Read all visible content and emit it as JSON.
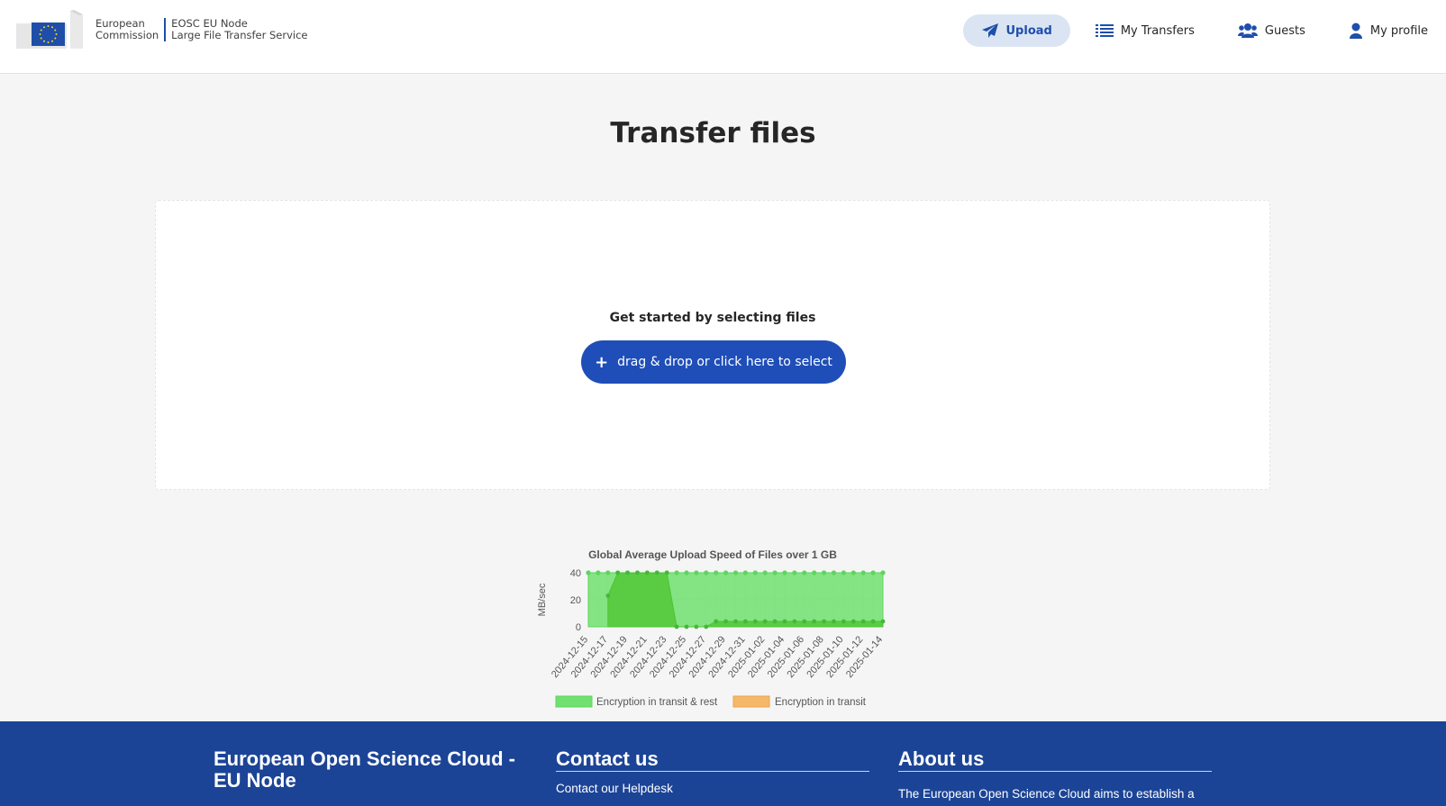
{
  "header": {
    "logo": {
      "line1": "European",
      "line2": "Commission"
    },
    "site": {
      "line1": "EOSC EU Node",
      "line2": "Large File Transfer Service"
    },
    "nav": [
      {
        "label": "Upload",
        "icon": "paper-plane-icon",
        "active": true
      },
      {
        "label": "My Transfers",
        "icon": "list-icon",
        "active": false
      },
      {
        "label": "Guests",
        "icon": "users-icon",
        "active": false
      },
      {
        "label": "My profile",
        "icon": "user-icon",
        "active": false
      }
    ]
  },
  "main": {
    "title": "Transfer files",
    "dropzone": {
      "heading": "Get started by selecting files",
      "button_label": "drag & drop or click here to select",
      "button_icon": "plus-icon"
    }
  },
  "chart_data": {
    "type": "area",
    "title": "Global Average Upload Speed of Files over 1 GB",
    "ylabel": "MB/sec",
    "xlabel": "",
    "ylim": [
      0,
      40
    ],
    "yticks": [
      0,
      20,
      40
    ],
    "grid": true,
    "legend_position": "bottom",
    "x": [
      "2024-12-15",
      "2024-12-16",
      "2024-12-17",
      "2024-12-18",
      "2024-12-19",
      "2024-12-20",
      "2024-12-21",
      "2024-12-22",
      "2024-12-23",
      "2024-12-24",
      "2024-12-25",
      "2024-12-26",
      "2024-12-27",
      "2024-12-28",
      "2024-12-29",
      "2024-12-30",
      "2024-12-31",
      "2025-01-01",
      "2025-01-02",
      "2025-01-03",
      "2025-01-04",
      "2025-01-05",
      "2025-01-06",
      "2025-01-07",
      "2025-01-08",
      "2025-01-09",
      "2025-01-10",
      "2025-01-11",
      "2025-01-12",
      "2025-01-13",
      "2025-01-14"
    ],
    "xtick_labels": [
      "2024-12-15",
      "2024-12-17",
      "2024-12-19",
      "2024-12-21",
      "2024-12-23",
      "2024-12-25",
      "2024-12-27",
      "2024-12-29",
      "2024-12-31",
      "2025-01-02",
      "2025-01-04",
      "2025-01-06",
      "2025-01-08",
      "2025-01-10",
      "2025-01-12",
      "2025-01-14"
    ],
    "series": [
      {
        "name": "Encryption in transit & rest",
        "color": "#70e070",
        "values": [
          40,
          40,
          40,
          40,
          40,
          40,
          40,
          40,
          40,
          40,
          40,
          40,
          40,
          40,
          40,
          40,
          40,
          40,
          40,
          40,
          40,
          40,
          40,
          40,
          40,
          40,
          40,
          40,
          40,
          40,
          40
        ]
      },
      {
        "name": "Encryption in transit",
        "color": "#f5b86a",
        "values": [
          null,
          null,
          23,
          40,
          40,
          40,
          40,
          40,
          40,
          0,
          0,
          0,
          0,
          4,
          4,
          4,
          4,
          4,
          4,
          4,
          4,
          4,
          4,
          4,
          4,
          4,
          4,
          4,
          4,
          4,
          4
        ]
      }
    ]
  },
  "footer": {
    "col1": {
      "title": "European Open Science Cloud - EU Node"
    },
    "col2": {
      "title": "Contact us",
      "text": "Contact our Helpdesk"
    },
    "col3": {
      "title": "About us",
      "text": "The European Open Science Cloud aims to establish a"
    }
  }
}
